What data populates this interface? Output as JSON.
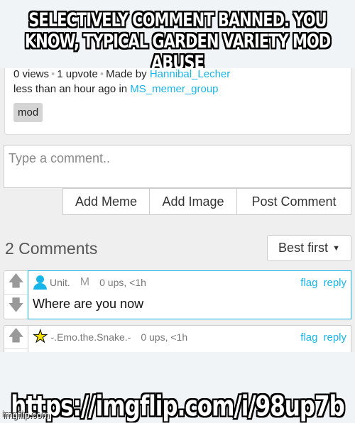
{
  "caption": {
    "top": "SELECTIVELY COMMENT BANNED. YOU KNOW, TYPICAL GARDEN VARIETY MOD ABUSE",
    "bottom": "https://imgflip.com/i/98up7b",
    "watermark": "imgflip.com"
  },
  "post": {
    "views": "0 views",
    "upvotes": "1 upvote",
    "made_by": "Made by",
    "author": "Hannibal_Lecher",
    "time": "less than an hour ago in",
    "stream": "MS_memer_group",
    "tag": "mod"
  },
  "composer": {
    "placeholder": "Type a comment..",
    "add_meme": "Add Meme",
    "add_image": "Add Image",
    "post_comment": "Post Comment"
  },
  "comments_header": {
    "count": "2 Comments",
    "sort": "Best first"
  },
  "comments": [
    {
      "user": "Unit.",
      "badge": "M",
      "meta": "0 ups, <1h",
      "flag": "flag",
      "reply": "reply",
      "text": "Where are you now",
      "avatar": "user-icon"
    },
    {
      "user": "-.Emo.the.Snake.-",
      "meta": "0 ups, <1h",
      "flag": "flag",
      "reply": "reply",
      "avatar": "star-icon"
    }
  ],
  "colors": {
    "link": "#19b5e6",
    "star": "#f5e000"
  }
}
